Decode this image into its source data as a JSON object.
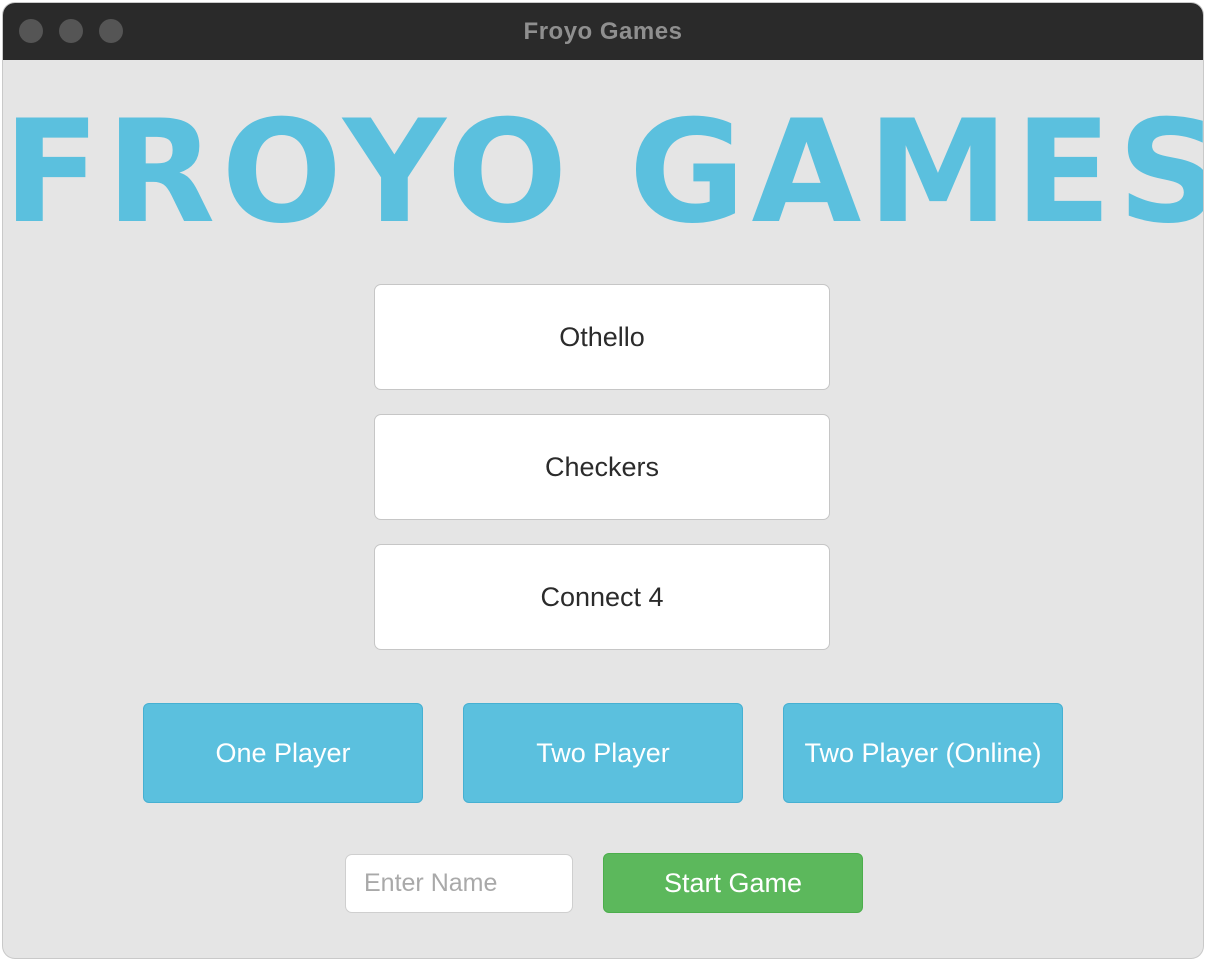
{
  "window": {
    "title": "Froyo Games"
  },
  "hero": {
    "title": "FROYO GAMES"
  },
  "games": [
    {
      "label": "Othello"
    },
    {
      "label": "Checkers"
    },
    {
      "label": "Connect 4"
    }
  ],
  "modes": [
    {
      "label": "One Player"
    },
    {
      "label": "Two Player"
    },
    {
      "label": "Two Player (Online)"
    }
  ],
  "name_input": {
    "value": "",
    "placeholder": "Enter Name"
  },
  "start_button": {
    "label": "Start Game"
  },
  "colors": {
    "accent_blue": "#5bc0de",
    "start_green": "#5cb85c",
    "background": "#e5e5e5",
    "titlebar": "#2a2a2a"
  }
}
